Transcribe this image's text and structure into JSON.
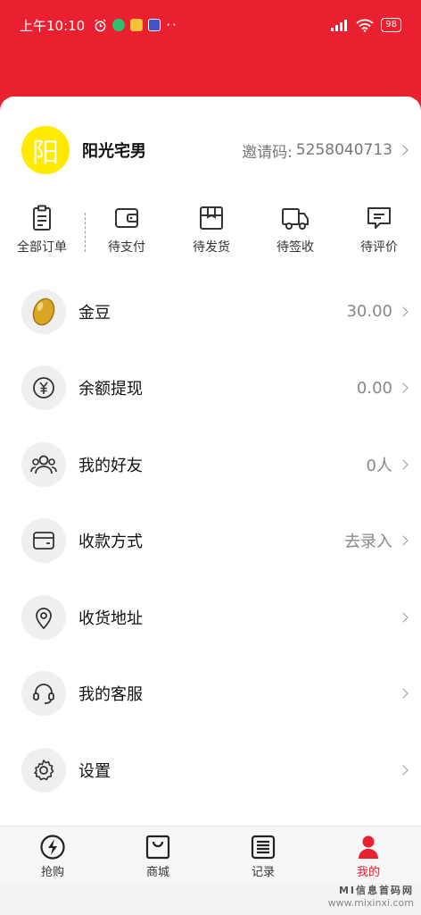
{
  "status_bar": {
    "time": "上午10:10",
    "battery": "98"
  },
  "profile": {
    "avatar_char": "阳",
    "username": "阳光宅男",
    "invite_label": "邀请码:",
    "invite_code": "5258040713"
  },
  "orders": [
    {
      "label": "全部订单",
      "icon": "clipboard-icon"
    },
    {
      "label": "待支付",
      "icon": "wallet-icon"
    },
    {
      "label": "待发货",
      "icon": "box-icon"
    },
    {
      "label": "待签收",
      "icon": "truck-icon"
    },
    {
      "label": "待评价",
      "icon": "comment-icon"
    }
  ],
  "menu": [
    {
      "label": "金豆",
      "value": "30.00",
      "icon": "bean-icon"
    },
    {
      "label": "余额提现",
      "value": "0.00",
      "icon": "yen-icon"
    },
    {
      "label": "我的好友",
      "value": "0人",
      "icon": "friends-icon"
    },
    {
      "label": "收款方式",
      "value": "去录入",
      "icon": "card-icon"
    },
    {
      "label": "收货地址",
      "value": "",
      "icon": "location-icon"
    },
    {
      "label": "我的客服",
      "value": "",
      "icon": "headset-icon"
    },
    {
      "label": "设置",
      "value": "",
      "icon": "gear-icon"
    }
  ],
  "tabs": [
    {
      "label": "抢购",
      "icon": "lightning-icon"
    },
    {
      "label": "商城",
      "icon": "bag-icon"
    },
    {
      "label": "记录",
      "icon": "list-icon"
    },
    {
      "label": "我的",
      "icon": "person-icon",
      "active": true
    }
  ],
  "watermark": {
    "main": "MI信息首码网",
    "sub": "www.mixinxi.com"
  },
  "colors": {
    "brand_red": "#e8202f",
    "avatar_yellow": "#ffea00",
    "bean_gold": "#d9a625"
  }
}
